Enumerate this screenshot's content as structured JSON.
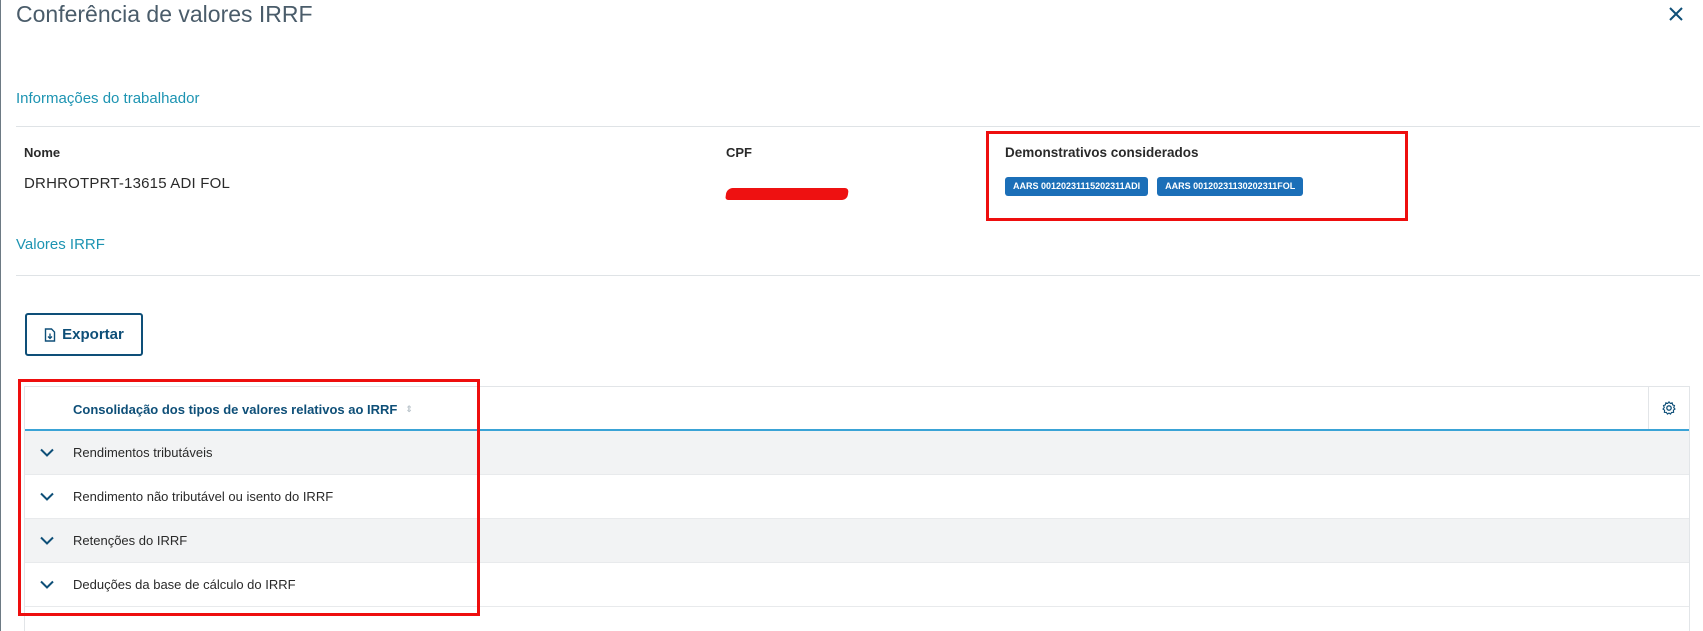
{
  "modal": {
    "title": "Conferência de valores IRRF",
    "close_icon": "close-icon"
  },
  "worker_info": {
    "section_title": "Informações do trabalhador",
    "name_label": "Nome",
    "name_value": "DRHROTPRT-13615 ADI FOL",
    "cpf_label": "CPF",
    "statements_label": "Demonstrativos considerados",
    "statements": [
      "AARS 00120231115202311ADI",
      "AARS 00120231130202311FOL"
    ]
  },
  "irrf_values": {
    "section_title": "Valores IRRF",
    "export_label": "Exportar",
    "export_icon": "file-export-icon",
    "table": {
      "column_header": "Consolidação dos tipos de valores relativos ao IRRF",
      "settings_icon": "gear-icon",
      "rows": [
        "Rendimentos tributáveis",
        "Rendimento não tributável ou isento do IRRF",
        "Retenções do IRRF",
        "Deduções da base de cálculo do IRRF"
      ]
    }
  },
  "colors": {
    "title": "#4a5c6a",
    "section": "#1d94b2",
    "primary": "#0e4f78",
    "tag": "#1b6fb8",
    "highlight": "#ee0e0e"
  }
}
